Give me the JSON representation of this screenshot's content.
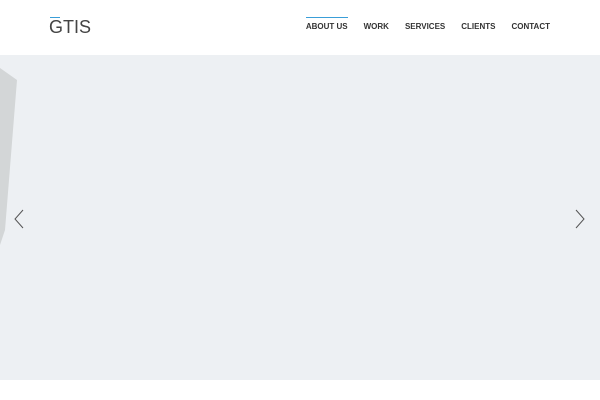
{
  "logo": "GTIS",
  "nav": [
    {
      "label": "ABOUT US",
      "active": true
    },
    {
      "label": "WORK"
    },
    {
      "label": "SERVICES"
    },
    {
      "label": "CLIENTS"
    },
    {
      "label": "CONTACT"
    }
  ],
  "accent": "#3a9ed8"
}
